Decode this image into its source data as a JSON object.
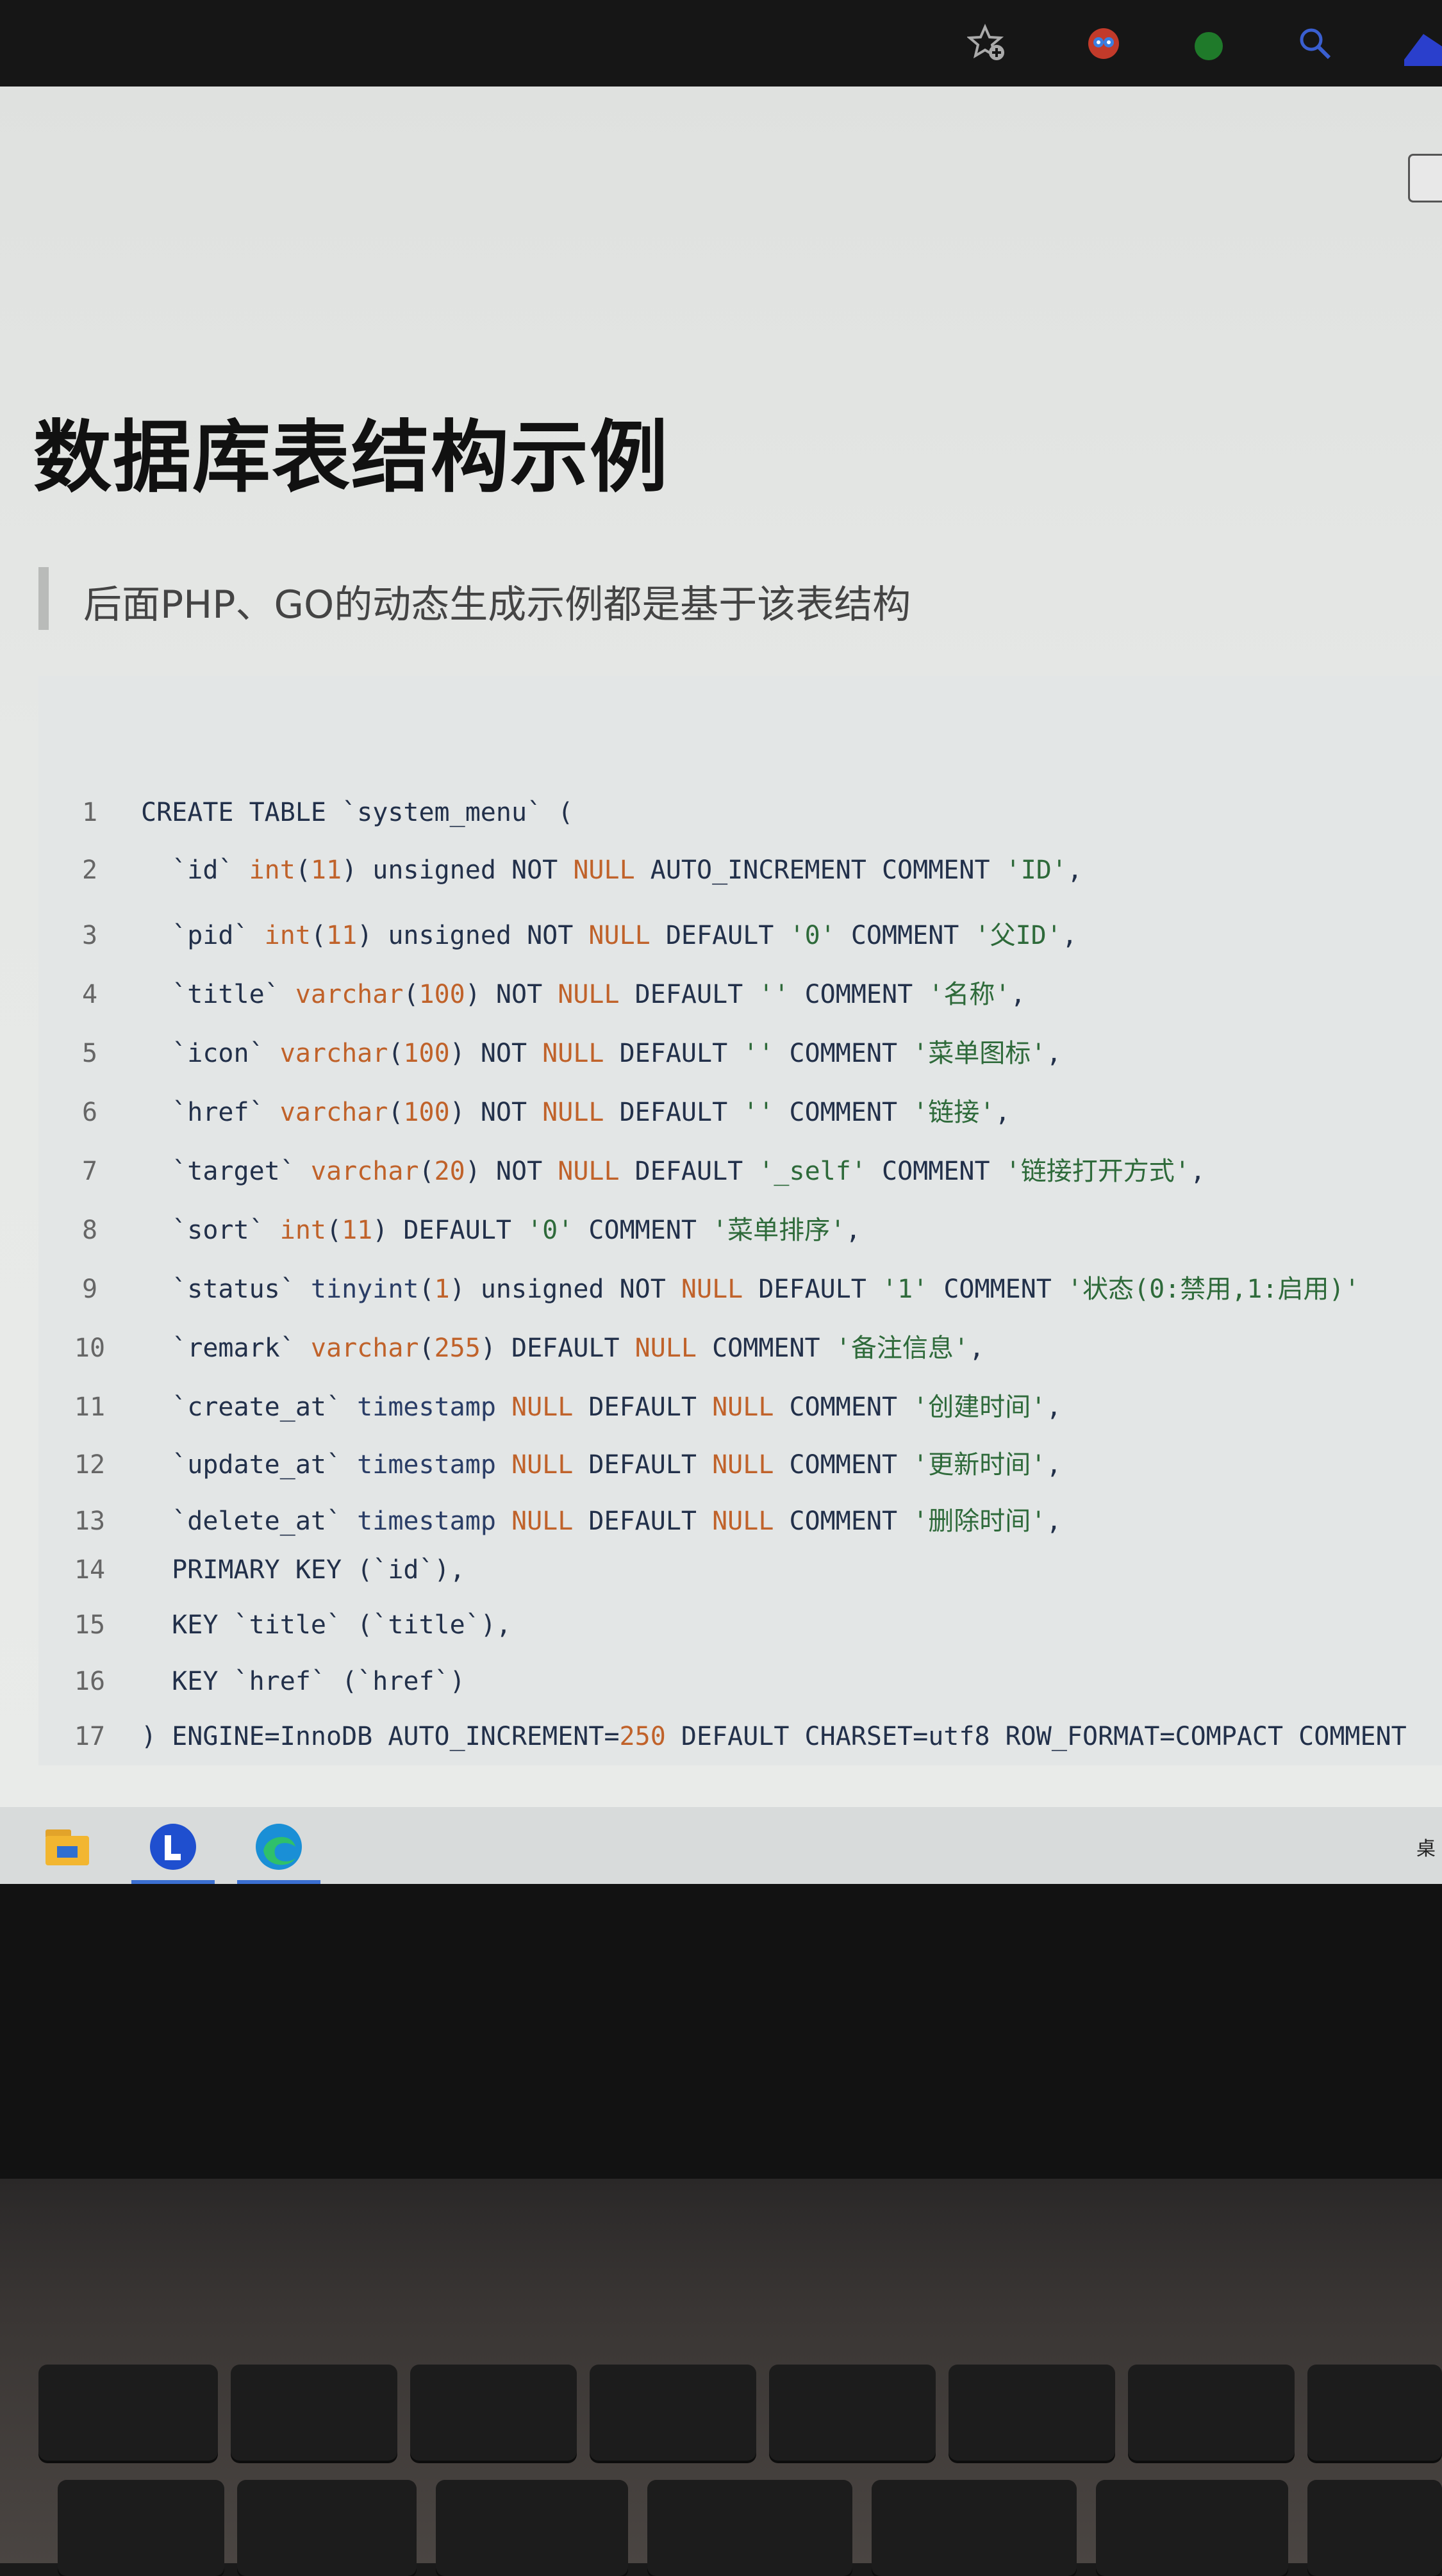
{
  "toolbar": {
    "icons": [
      "star-add-icon",
      "extension-icon",
      "green-extension-icon",
      "search-icon",
      "profile-icon"
    ]
  },
  "page": {
    "title": "数据库表结构示例",
    "quote": "后面PHP、GO的动态生成示例都是基于该表结构"
  },
  "code": {
    "lines": [
      {
        "n": "1",
        "text": "CREATE TABLE `system_menu` ("
      },
      {
        "n": "2",
        "text": "  `id` int(11) unsigned NOT NULL AUTO_INCREMENT COMMENT 'ID',"
      },
      {
        "n": "3",
        "text": "  `pid` int(11) unsigned NOT NULL DEFAULT '0' COMMENT '父ID',"
      },
      {
        "n": "4",
        "text": "  `title` varchar(100) NOT NULL DEFAULT '' COMMENT '名称',"
      },
      {
        "n": "5",
        "text": "  `icon` varchar(100) NOT NULL DEFAULT '' COMMENT '菜单图标',"
      },
      {
        "n": "6",
        "text": "  `href` varchar(100) NOT NULL DEFAULT '' COMMENT '链接',"
      },
      {
        "n": "7",
        "text": "  `target` varchar(20) NOT NULL DEFAULT '_self' COMMENT '链接打开方式',"
      },
      {
        "n": "8",
        "text": "  `sort` int(11) DEFAULT '0' COMMENT '菜单排序',"
      },
      {
        "n": "9",
        "text": "  `status` tinyint(1) unsigned NOT NULL DEFAULT '1' COMMENT '状态(0:禁用,1:启用)'"
      },
      {
        "n": "10",
        "text": "  `remark` varchar(255) DEFAULT NULL COMMENT '备注信息',"
      },
      {
        "n": "11",
        "text": "  `create_at` timestamp NULL DEFAULT NULL COMMENT '创建时间',"
      },
      {
        "n": "12",
        "text": "  `update_at` timestamp NULL DEFAULT NULL COMMENT '更新时间',"
      },
      {
        "n": "13",
        "text": "  `delete_at` timestamp NULL DEFAULT NULL COMMENT '删除时间',"
      },
      {
        "n": "14",
        "text": "  PRIMARY KEY (`id`),"
      },
      {
        "n": "15",
        "text": "  KEY `title` (`title`),"
      },
      {
        "n": "16",
        "text": "  KEY `href` (`href`)"
      },
      {
        "n": "17",
        "text": ") ENGINE=InnoDB AUTO_INCREMENT=250 DEFAULT CHARSET=utf8 ROW_FORMAT=COMPACT COMMENT"
      }
    ]
  },
  "taskbar": {
    "apps": [
      "file-explorer-icon",
      "l-app-icon",
      "edge-browser-icon"
    ],
    "corner_text": "桌"
  },
  "colors": {
    "keyword": "#2a3d66",
    "type": "#c0622a",
    "string": "#2e6a3a",
    "accent": "#3b6fd1"
  }
}
